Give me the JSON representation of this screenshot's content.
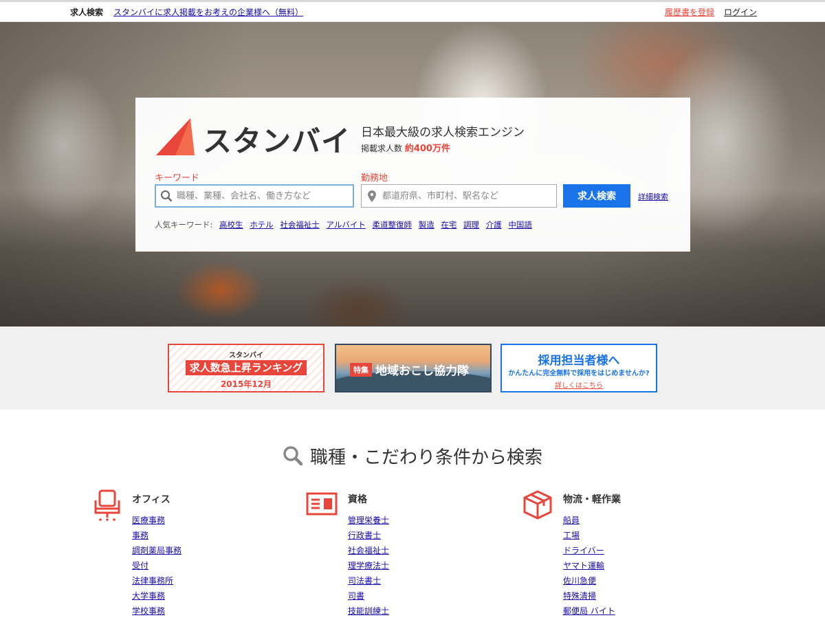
{
  "topbar": {
    "brand": "求人検索",
    "promo_link": "スタンバイに求人掲載をお考えの企業様へ（無料）",
    "resume_link": "履歴書を登録",
    "login_link": "ログイン"
  },
  "search": {
    "logo_text": "スタンバイ",
    "tagline": "日本最大級の求人検索エンジン",
    "count_label": "掲載求人数",
    "count_value": "約400万件",
    "keyword_label": "キーワード",
    "keyword_placeholder": "職種、業種、会社名、働き方など",
    "location_label": "勤務地",
    "location_placeholder": "都道府県、市町村、駅名など",
    "search_button": "求人検索",
    "advanced_link": "詳細検索",
    "popular_label": "人気キーワード:",
    "popular_keywords": [
      "高校生",
      "ホテル",
      "社会福祉士",
      "アルバイト",
      "柔道整復師",
      "製造",
      "在宅",
      "調理",
      "介護",
      "中国語"
    ]
  },
  "banners": {
    "ranking": {
      "small": "スタンバイ",
      "big": "求人数急上昇ランキング",
      "date": "2015年12月"
    },
    "regional": {
      "tag": "特集",
      "title": "地域おこし協力隊"
    },
    "employer": {
      "title": "採用担当者様へ",
      "subtitle": "かんたんに完全無料で採用をはじめませんか?",
      "link": "詳しくはこちら"
    }
  },
  "categories": {
    "section_title": "職種・こだわり条件から検索",
    "columns": [
      {
        "heading": "オフィス",
        "icon": "office-chair-icon",
        "items": [
          "医療事務",
          "事務",
          "調剤薬局事務",
          "受付",
          "法律事務所",
          "大学事務",
          "学校事務"
        ]
      },
      {
        "heading": "資格",
        "icon": "id-card-icon",
        "items": [
          "管理栄養士",
          "行政書士",
          "社会福祉士",
          "理学療法士",
          "司法書士",
          "司書",
          "技能訓練士"
        ]
      },
      {
        "heading": "物流・軽作業",
        "icon": "box-icon",
        "items": [
          "船員",
          "工場",
          "ドライバー",
          "ヤマト運輸",
          "佐川急便",
          "特殊清掃",
          "郵便局 バイト"
        ]
      }
    ]
  },
  "colors": {
    "accent": "#e8463a",
    "primary": "#1a73e8",
    "link": "#1a0dab"
  }
}
